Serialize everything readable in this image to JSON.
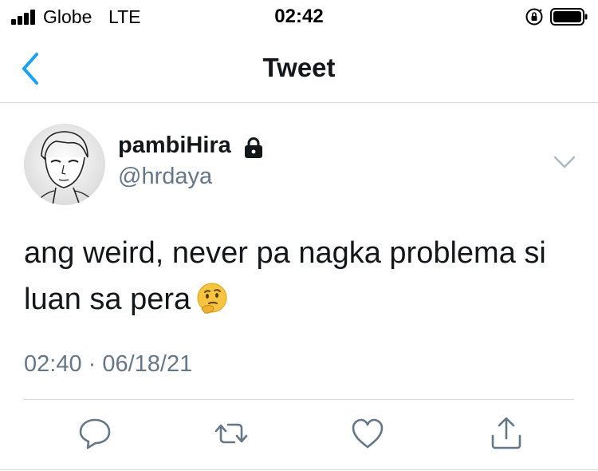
{
  "status_bar": {
    "carrier": "Globe",
    "network": "LTE",
    "time": "02:42"
  },
  "nav": {
    "title": "Tweet",
    "back_icon": "chevron-left-icon"
  },
  "tweet": {
    "display_name": "pambiHira",
    "handle": "@hrdaya",
    "protected_icon": "lock-icon",
    "text_line1": "ang weird, never pa nagka problema si",
    "text_line2": "luan sa pera",
    "emoji_icon": "thinking-face-icon",
    "time": "02:40",
    "separator": " · ",
    "date": "06/18/21"
  },
  "actions": [
    "reply-icon",
    "retweet-icon",
    "like-icon",
    "share-icon"
  ],
  "colors": {
    "accent": "#1da1f2",
    "text": "#14171a",
    "secondary": "#657786",
    "divider": "#d7dadd",
    "icon_gray": "#657786"
  }
}
